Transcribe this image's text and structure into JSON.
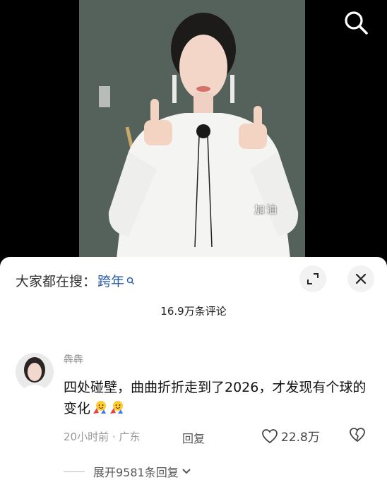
{
  "search_bar": {
    "prefix": "大家都在搜：",
    "keyword": "跨年"
  },
  "video": {
    "subtitle": "加油"
  },
  "comments_header": {
    "count_label": "16.9万条评论"
  },
  "comment": {
    "author": "犇犇",
    "text": "四处碰壁，曲曲折折走到了2026，才发现有个球的变化",
    "time_location": "20小时前 · 广东",
    "reply_label": "回复",
    "like_count": "22.8万",
    "expand_label": "展开9581条回复"
  },
  "colors": {
    "keyword_blue": "#2a5aa8",
    "video_bg": "#536059"
  }
}
